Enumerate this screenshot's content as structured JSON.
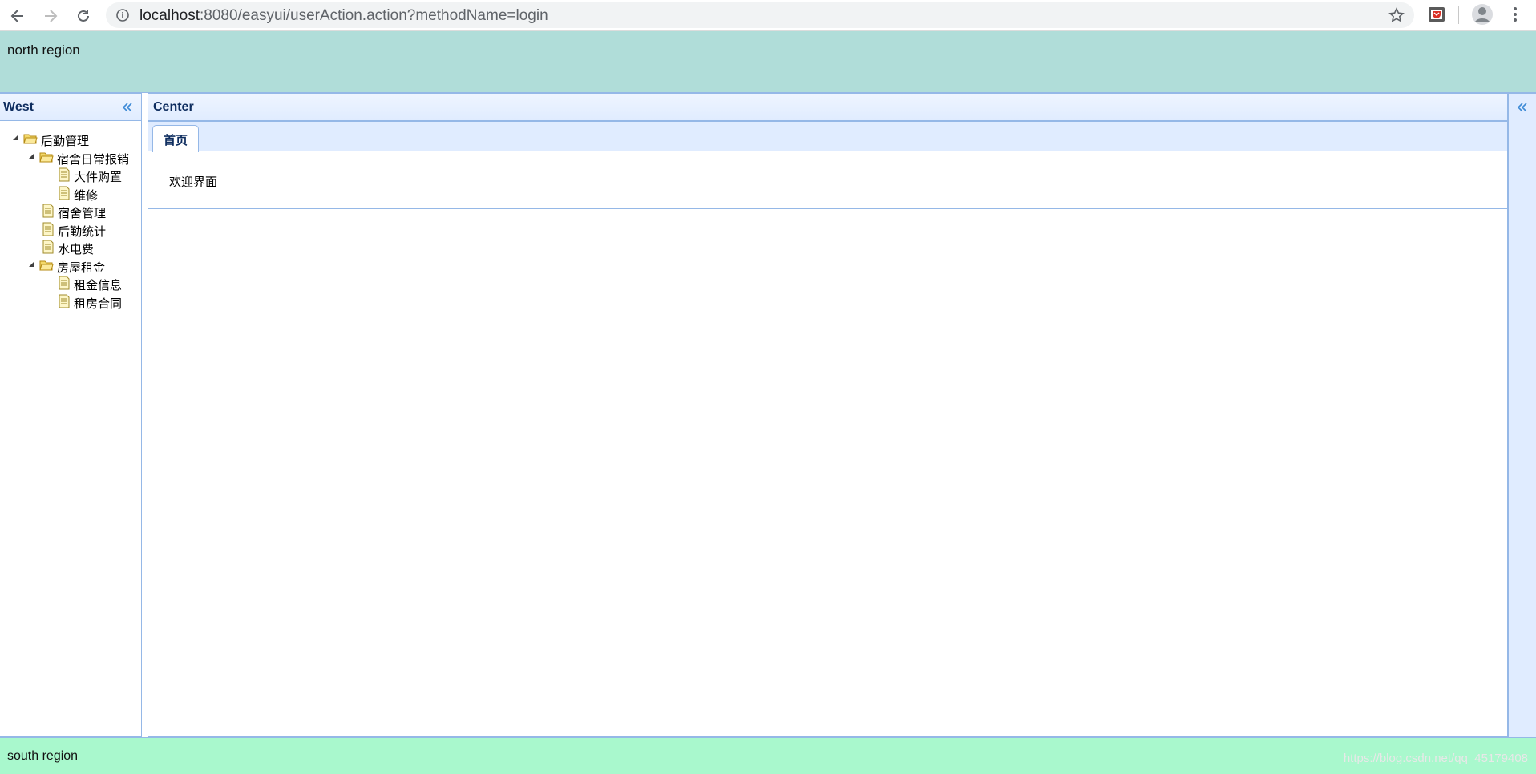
{
  "browser": {
    "url_host": "localhost",
    "url_rest": ":8080/easyui/userAction.action?methodName=login"
  },
  "north": {
    "label": "north region"
  },
  "west": {
    "title": "West",
    "tree": [
      {
        "label": "后勤管理",
        "type": "folder",
        "expanded": true
      },
      {
        "label": "宿舍日常报销",
        "type": "folder",
        "expanded": true
      },
      {
        "label": "大件购置",
        "type": "file"
      },
      {
        "label": "维修",
        "type": "file"
      },
      {
        "label": "宿舍管理",
        "type": "file"
      },
      {
        "label": "后勤统计",
        "type": "file"
      },
      {
        "label": "水电费",
        "type": "file"
      },
      {
        "label": "房屋租金",
        "type": "folder",
        "expanded": true
      },
      {
        "label": "租金信息",
        "type": "file"
      },
      {
        "label": "租房合同",
        "type": "file"
      }
    ]
  },
  "center": {
    "title": "Center",
    "tabs": [
      {
        "label": "首页"
      }
    ],
    "tab_content": "欢迎界面"
  },
  "south": {
    "label": "south region",
    "watermark": "https://blog.csdn.net/qq_45179408"
  },
  "colors": {
    "north_bg": "#b0ddd9",
    "south_bg": "#a9f8cd",
    "panel_border": "#95b8e7",
    "header_bg": "#e0ecff",
    "title_text": "#0e2d5f"
  }
}
